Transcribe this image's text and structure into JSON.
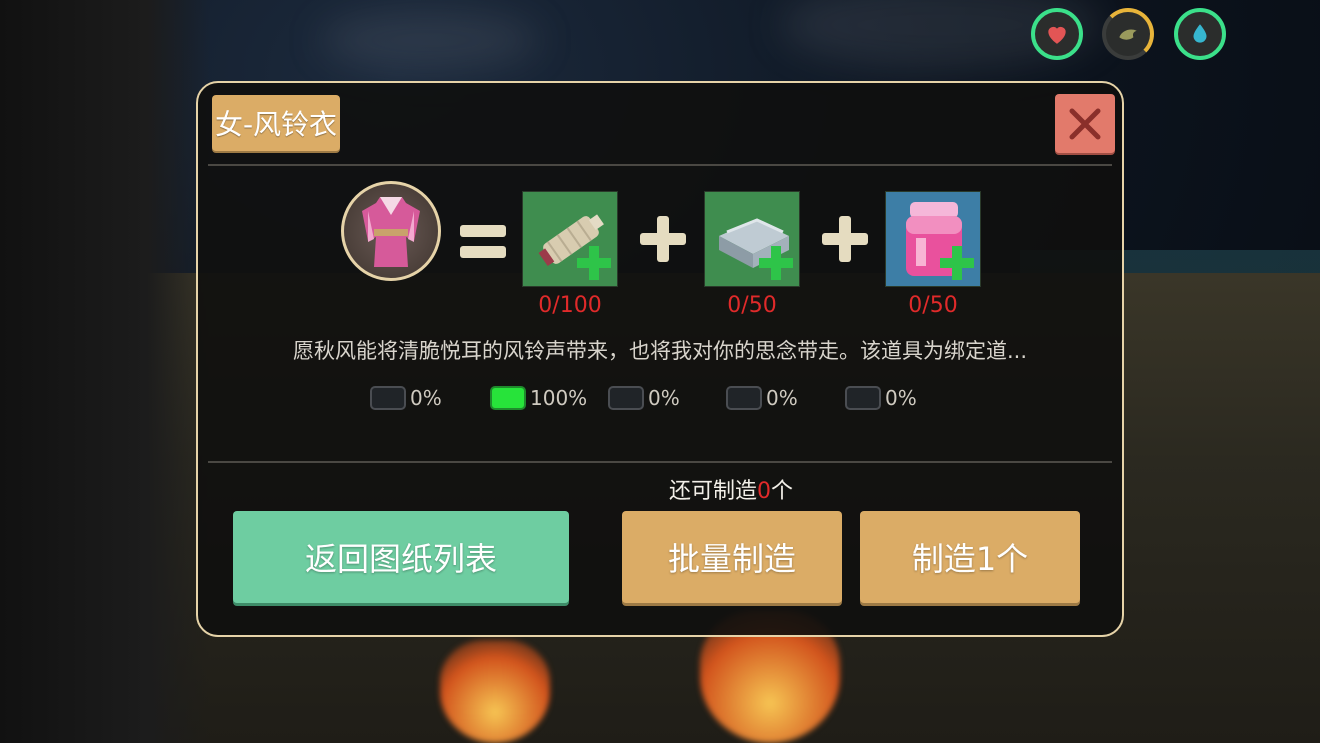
{
  "status_icons": [
    {
      "name": "health",
      "icon": "heart-icon",
      "ring": "#3be08a"
    },
    {
      "name": "hunger",
      "icon": "food-icon",
      "ring": "#e8b43a"
    },
    {
      "name": "thirst",
      "icon": "water-drop-icon",
      "ring": "#3be08a"
    }
  ],
  "dialog": {
    "title": "女-风铃衣",
    "result_icon": "robe-icon",
    "materials": [
      {
        "icon": "thread-spool-icon",
        "count": "0/100",
        "bg": "#3f8d4f"
      },
      {
        "icon": "cloth-icon",
        "count": "0/50",
        "bg": "#3f8d4f"
      },
      {
        "icon": "dye-jar-icon",
        "count": "0/50",
        "bg": "#3d7ea6"
      }
    ],
    "description": "愿秋风能将清脆悦耳的风铃声带来，也将我对你的思念带走。该道具为绑定道...",
    "quality_rates": [
      {
        "value": "0%",
        "active": false
      },
      {
        "value": "100%",
        "active": true
      },
      {
        "value": "0%",
        "active": false
      },
      {
        "value": "0%",
        "active": false
      },
      {
        "value": "0%",
        "active": false
      }
    ],
    "remaining": {
      "prefix": "还可制造",
      "count": "0",
      "suffix": "个"
    },
    "buttons": {
      "back": "返回图纸列表",
      "batch": "批量制造",
      "craft_one": "制造1个"
    }
  }
}
